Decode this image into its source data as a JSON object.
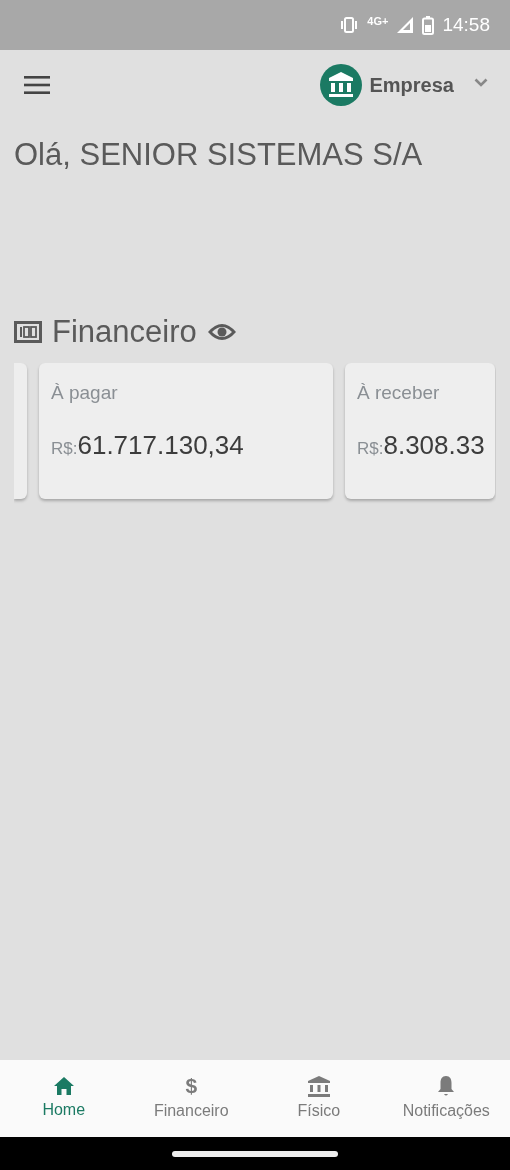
{
  "status_bar": {
    "network": "4G+",
    "time": "14:58"
  },
  "header": {
    "company": "Empresa"
  },
  "greeting": "Olá, SENIOR SISTEMAS S/A",
  "section": {
    "title": "Financeiro"
  },
  "cards": [
    {
      "kind": "edge"
    },
    {
      "kind": "amount",
      "label": "À pagar",
      "currency": "R$:",
      "value": "61.717.130,34"
    },
    {
      "kind": "amount",
      "label": "À receber",
      "currency": "R$:",
      "value": "8.308.33"
    }
  ],
  "bottom_nav": [
    {
      "kind": "home",
      "label": "Home",
      "selected": true
    },
    {
      "kind": "glyph",
      "glyph": "$",
      "label": "Financeiro",
      "selected": false
    },
    {
      "kind": "bank",
      "label": "Físico",
      "selected": false
    },
    {
      "kind": "bell",
      "label": "Notificações",
      "selected": false
    }
  ]
}
